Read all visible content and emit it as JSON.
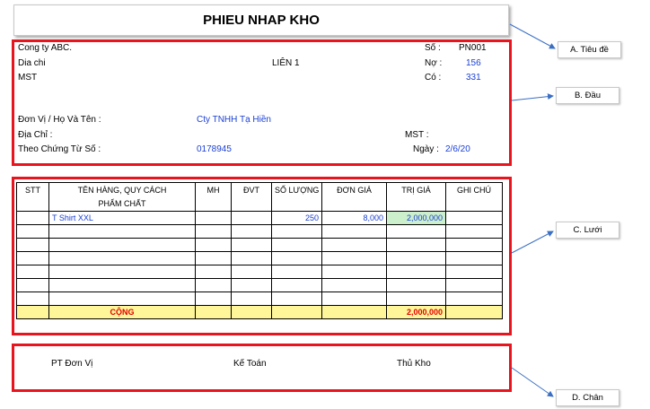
{
  "title": "PHIEU NHAP KHO",
  "header": {
    "company": "Cong ty ABC.",
    "address_label": "Dia chi",
    "tax_label": "MST",
    "copy_label": "LIÊN 1",
    "no_label": "Số :",
    "no_value": "PN001",
    "debit_label": "Nợ :",
    "debit_value": "156",
    "credit_label": "Có :",
    "credit_value": "331",
    "unit_label": "Đơn Vị / Họ Và Tên :",
    "unit_value": "Cty TNHH Tạ Hiền",
    "addr2_label": "Địa Chỉ :",
    "mst2_label": "MST :",
    "voucher_label": "Theo Chứng Từ Số :",
    "voucher_value": "0178945",
    "date_label": "Ngày :",
    "date_value": "2/6/20"
  },
  "grid": {
    "columns": [
      "STT",
      "TÊN HÀNG, QUY CÁCH",
      "MH",
      "ĐVT",
      "SỐ LƯỢNG",
      "ĐƠN GIÁ",
      "TRỊ GIÁ",
      "GHI CHÚ"
    ],
    "column2_line2": "PHẨM CHẤT",
    "row1": {
      "name": "T Shirt XXL",
      "qty": "250",
      "price": "8,000",
      "value": "2,000,000"
    },
    "total_label": "CỘNG",
    "total_value": "2,000,000"
  },
  "footer": {
    "sign1": "PT Đơn Vị",
    "sign2": "Kế Toán",
    "sign3": "Thủ Kho"
  },
  "callouts": {
    "a": "A. Tiêu đề",
    "b": "B. Đầu",
    "c": "C. Lưới",
    "d": "D. Chân"
  },
  "colors": {
    "frame": "#e8141e",
    "value_text": "#1a3fd4",
    "total_bg": "#fff599",
    "highlight": "#ccf0cc"
  }
}
